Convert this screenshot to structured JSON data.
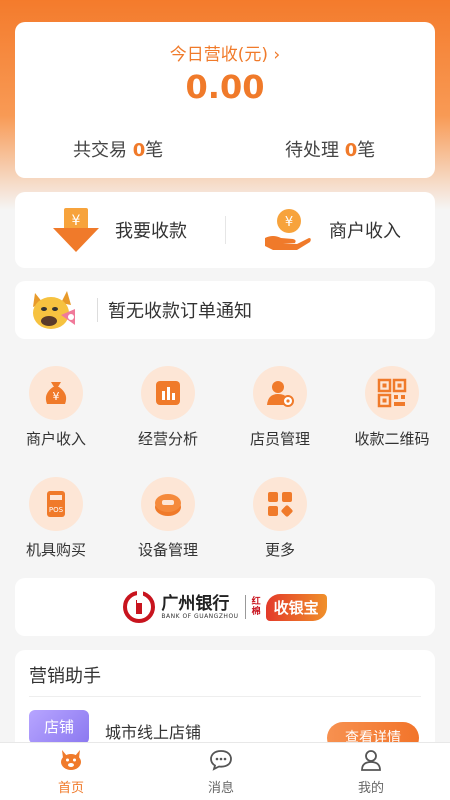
{
  "revenue": {
    "title": "今日营收(元)",
    "chevron": "›",
    "amount": "0.00",
    "total_prefix": "共交易",
    "total_count": "0",
    "total_suffix": "笔",
    "pending_prefix": "待处理",
    "pending_count": "0",
    "pending_suffix": "笔"
  },
  "actions": {
    "receive_label": "我要收款",
    "merchant_income_label": "商户收入"
  },
  "notice": {
    "text": "暂无收款订单通知"
  },
  "grid": [
    {
      "label": "商户收入",
      "icon": "money-bag-icon"
    },
    {
      "label": "经营分析",
      "icon": "bar-chart-icon"
    },
    {
      "label": "店员管理",
      "icon": "staff-icon"
    },
    {
      "label": "收款二维码",
      "icon": "qr-code-icon"
    },
    {
      "label": "机具购买",
      "icon": "pos-terminal-icon"
    },
    {
      "label": "设备管理",
      "icon": "device-icon"
    },
    {
      "label": "更多",
      "icon": "more-grid-icon"
    }
  ],
  "bank": {
    "name_cn": "广州银行",
    "name_en": "BANK OF GUANGZHOU",
    "product_small": "红棉",
    "product": "收银宝"
  },
  "marketing": {
    "title": "营销助手",
    "tag": "店铺",
    "shop_name": "城市线上店铺",
    "detail_button": "查看详情"
  },
  "nav": [
    {
      "label": "首页",
      "icon": "home-icon",
      "active": true
    },
    {
      "label": "消息",
      "icon": "message-icon",
      "active": false
    },
    {
      "label": "我的",
      "icon": "profile-icon",
      "active": false
    }
  ],
  "colors": {
    "accent": "#f07a2a",
    "icon_bg": "#fde6d6",
    "shop_tag": "#8b78f0"
  }
}
